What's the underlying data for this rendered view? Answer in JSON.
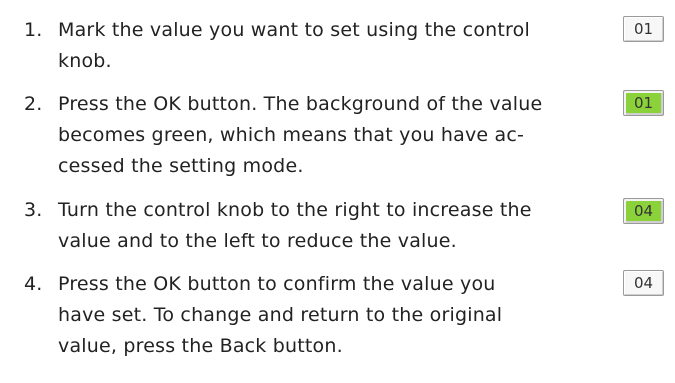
{
  "steps": [
    {
      "number": "1.",
      "text": "Mark the value you want to set using the control\nknob.",
      "value": "01",
      "value_state": "normal"
    },
    {
      "number": "2.",
      "text": "Press the OK button. The background of the value\nbecomes green, which means that you have ac-\ncessed the setting mode.",
      "value": "01",
      "value_state": "setting",
      "value_background": "#8bd23a"
    },
    {
      "number": "3.",
      "text": "Turn the control knob to the right to increase the\nvalue and to the left to reduce the value.",
      "value": "04",
      "value_state": "setting",
      "value_background": "#8bd23a"
    },
    {
      "number": "4.",
      "text": "Press the OK button to confirm the value you\nhave set. To change and return to the original\nvalue, press the Back button.",
      "value": "04",
      "value_state": "normal"
    }
  ]
}
